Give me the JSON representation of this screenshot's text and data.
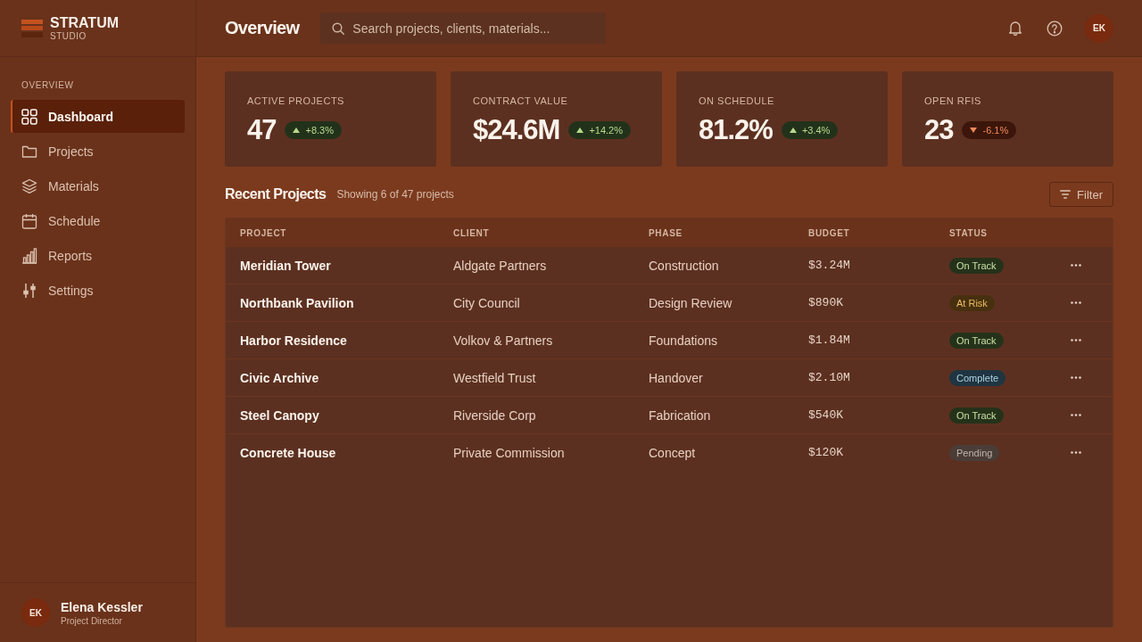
{
  "sidebar": {
    "brand": {
      "name": "STRATUM",
      "tagline": "STUDIO"
    },
    "section_label": "OVERVIEW",
    "items": [
      {
        "label": "Dashboard",
        "selected": true
      },
      {
        "label": "Projects",
        "selected": false
      },
      {
        "label": "Materials",
        "selected": false
      },
      {
        "label": "Schedule",
        "selected": false
      },
      {
        "label": "Reports",
        "selected": false
      },
      {
        "label": "Settings",
        "selected": false
      }
    ],
    "user": {
      "initials": "EK",
      "name": "Elena Kessler",
      "role": "Project Director"
    }
  },
  "header": {
    "title": "Overview",
    "search": {
      "placeholder": "Search projects, clients, materials..."
    },
    "avatar": {
      "initials": "EK"
    }
  },
  "stats": [
    {
      "label": "ACTIVE PROJECTS",
      "value": "47",
      "delta": "+8.3%",
      "kind": "up"
    },
    {
      "label": "CONTRACT VALUE",
      "value": "$24.6M",
      "delta": "+14.2%",
      "kind": "up"
    },
    {
      "label": "ON SCHEDULE",
      "value": "81.2%",
      "delta": "+3.4%",
      "kind": "up"
    },
    {
      "label": "OPEN RFIS",
      "value": "23",
      "delta": "-6.1%",
      "kind": "down"
    }
  ],
  "recent_projects": {
    "title": "Recent Projects",
    "subtitle": "Showing 6 of 47 projects",
    "filter_button": "Filter",
    "columns": [
      "PROJECT",
      "CLIENT",
      "PHASE",
      "BUDGET",
      "STATUS"
    ],
    "rows": [
      {
        "project": "Meridian Tower",
        "client": "Aldgate Partners",
        "phase": "Construction",
        "budget": "$3.24M",
        "status": {
          "label": "On Track",
          "kind": "success"
        }
      },
      {
        "project": "Northbank Pavilion",
        "client": "City Council",
        "phase": "Design Review",
        "budget": "$890K",
        "status": {
          "label": "At Risk",
          "kind": "warning"
        }
      },
      {
        "project": "Harbor Residence",
        "client": "Volkov & Partners",
        "phase": "Foundations",
        "budget": "$1.84M",
        "status": {
          "label": "On Track",
          "kind": "success"
        }
      },
      {
        "project": "Civic Archive",
        "client": "Westfield Trust",
        "phase": "Handover",
        "budget": "$2.10M",
        "status": {
          "label": "Complete",
          "kind": "info"
        }
      },
      {
        "project": "Steel Canopy",
        "client": "Riverside Corp",
        "phase": "Fabrication",
        "budget": "$540K",
        "status": {
          "label": "On Track",
          "kind": "success"
        }
      },
      {
        "project": "Concrete House",
        "client": "Private Commission",
        "phase": "Concept",
        "budget": "$120K",
        "status": {
          "label": "Pending",
          "kind": "neutral"
        }
      }
    ]
  }
}
